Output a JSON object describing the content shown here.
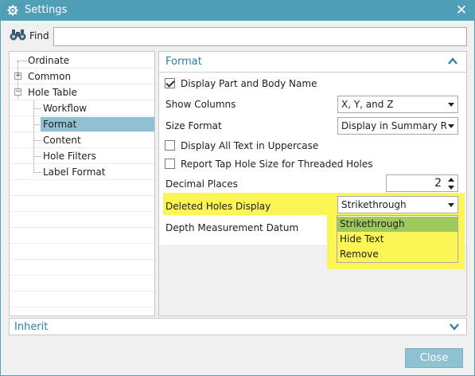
{
  "window": {
    "title": "Settings"
  },
  "find": {
    "label": "Find",
    "value": ""
  },
  "tree": {
    "items": [
      {
        "label": "Ordinate"
      },
      {
        "label": "Common"
      },
      {
        "label": "Hole Table"
      },
      {
        "label": "Workflow"
      },
      {
        "label": "Format"
      },
      {
        "label": "Content"
      },
      {
        "label": "Hole Filters"
      },
      {
        "label": "Label Format"
      }
    ],
    "toggles": {
      "common": "+",
      "hole_table": "−"
    }
  },
  "format": {
    "title": "Format",
    "display_part_body_name": {
      "label": "Display Part and Body Name",
      "checked": true
    },
    "show_columns": {
      "label": "Show Columns",
      "value": "X, Y, and Z"
    },
    "size_format": {
      "label": "Size Format",
      "value": "Display in Summary Ro"
    },
    "display_all_uppercase": {
      "label": "Display All Text in Uppercase",
      "checked": false
    },
    "report_tap_hole": {
      "label": "Report Tap Hole Size for Threaded Holes",
      "checked": false
    },
    "decimal_places": {
      "label": "Decimal Places",
      "value": "2"
    },
    "deleted_holes_display": {
      "label": "Deleted Holes Display",
      "value": "Strikethrough",
      "options": [
        "Strikethrough",
        "Hide Text",
        "Remove"
      ]
    },
    "depth_measurement_datum": {
      "label": "Depth Measurement Datum"
    }
  },
  "inherit": {
    "title": "Inherit"
  },
  "buttons": {
    "close": "Close"
  },
  "colors": {
    "titlebar": "#4f9fb8",
    "accent_text": "#2a7fa5",
    "highlight": "#fbf556",
    "selected_option": "#9fc95a",
    "tree_selected": "#8fc1d3"
  }
}
